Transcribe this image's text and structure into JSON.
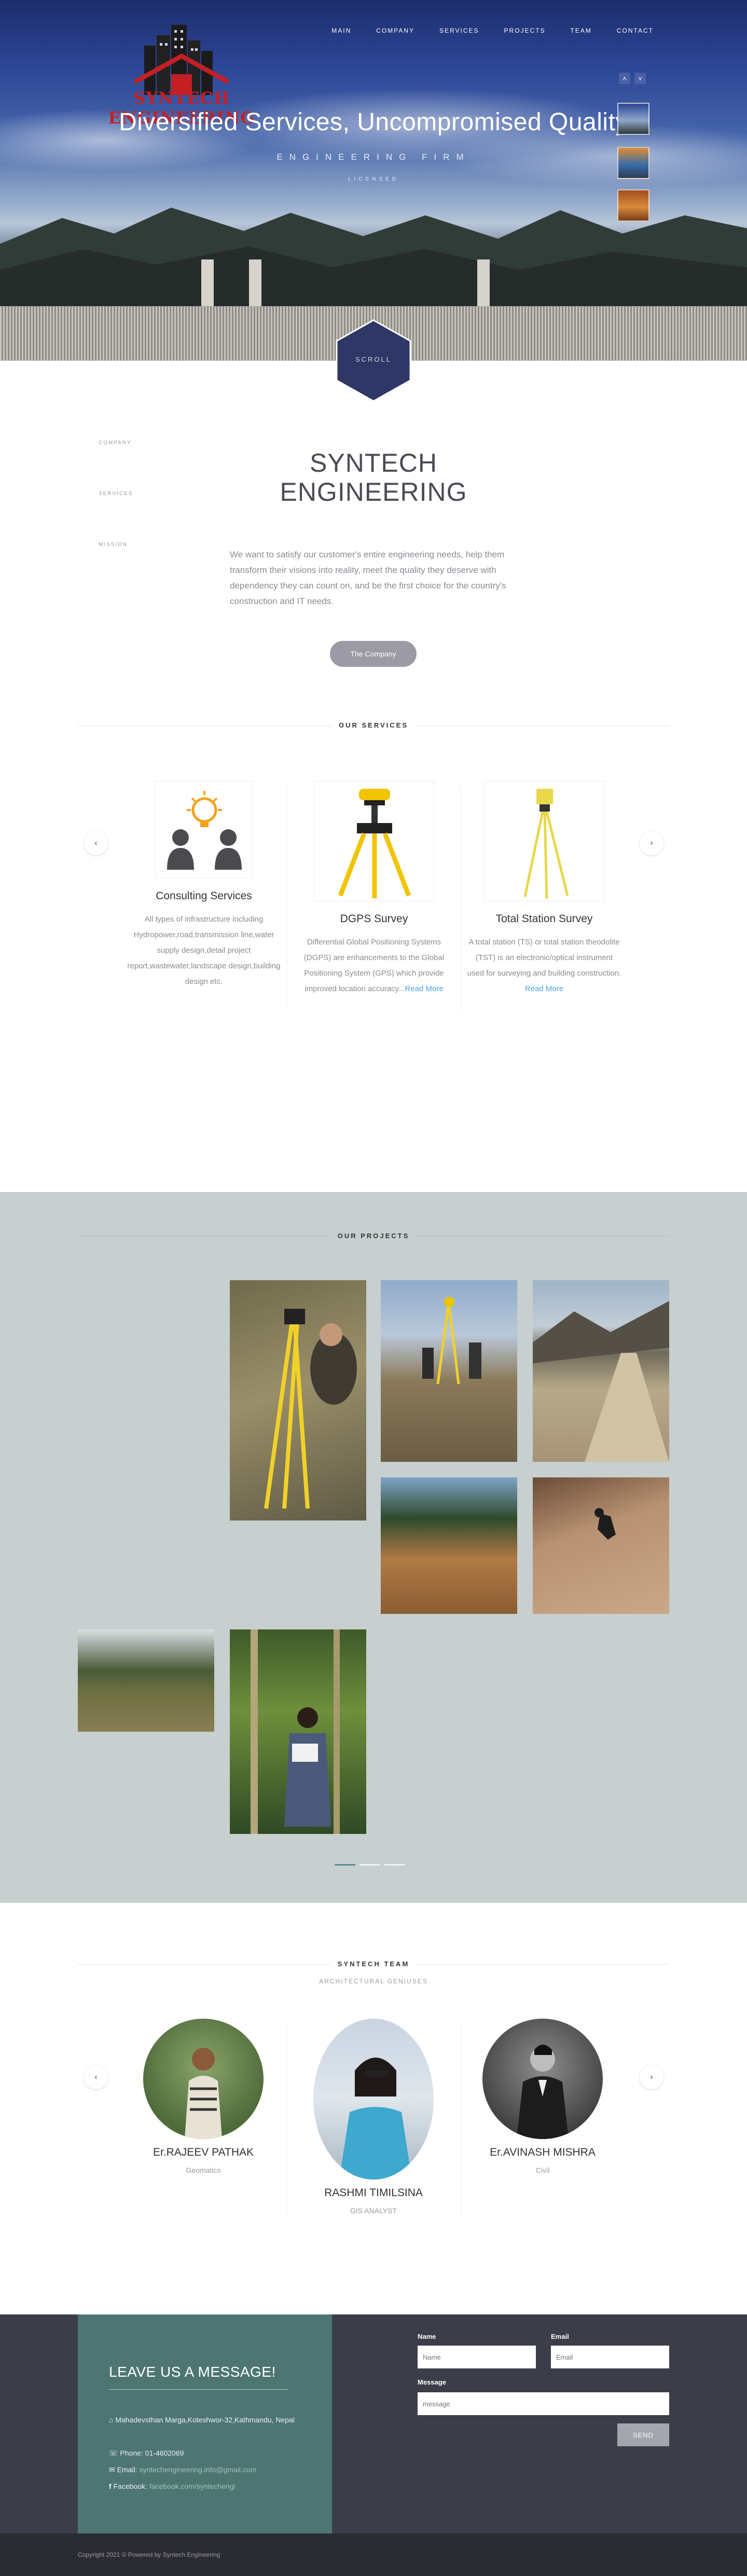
{
  "brand": {
    "name": "SYNTECH ENGINEERING",
    "color": "#c32026"
  },
  "nav": [
    "MAIN",
    "COMPANY",
    "SERVICES",
    "PROJECTS",
    "TEAM",
    "CONTACT"
  ],
  "hero": {
    "title": "Diversified Services, Uncompromised Quality",
    "subtitle": "ENGINEERING FIRM",
    "tagline": "LICENSED",
    "scroll_label": "SCROLL",
    "arrow_up": "˄",
    "arrow_down": "˅"
  },
  "about": {
    "side_links": [
      "COMPANY",
      "SERVICES",
      "MISSION"
    ],
    "title_line1": "SYNTECH",
    "title_line2": "ENGINEERING",
    "text": "We want to satisfy our customer's entire engineering needs, help them transform their visions into reality, meet the quality they deserve with dependency they can count on, and be the first choice for the country's construction and IT needs.",
    "button": "The Company"
  },
  "services": {
    "heading": "OUR SERVICES",
    "prev": "‹",
    "next": "›",
    "items": [
      {
        "title": "Consulting Services",
        "text": "All types of infrastructure including Hydropower,road,transmission line,water supply design,detail project report,wastewater,landscape design,building design etc.",
        "more": ""
      },
      {
        "title": "DGPS Survey",
        "text": "Differential Global Positioning Systems (DGPS) are enhancements to the Global Positioning System (GPS) which provide improved location accuracy...",
        "more": "Read More"
      },
      {
        "title": "Total Station Survey",
        "text": "A total station (TS) or total station theodolite (TST) is an electronic/optical instrument used for surveying and building construction.",
        "more": "Read More"
      }
    ]
  },
  "projects": {
    "heading": "OUR PROJECTS",
    "pages": 3,
    "active_page": 1
  },
  "team": {
    "heading": "SYNTECH TEAM",
    "subheading": "ARCHITECTURAL GENIUSES",
    "prev": "‹",
    "next": "›",
    "members": [
      {
        "name": "Er.RAJEEV PATHAK",
        "role": "Geomatics"
      },
      {
        "name": "RASHMI TIMILSINA",
        "role": "GIS ANALYST"
      },
      {
        "name": "Er.AVINASH MISHRA",
        "role": "Civil"
      }
    ]
  },
  "contact": {
    "title": "LEAVE US A MESSAGE!",
    "address": "Mahadevsthan Marga,Koteshwor-32,Kathmandu, Nepal",
    "phone_label": "Phone:",
    "phone": "01-4602069",
    "email_label": "Email:",
    "email": "syntechengineering.info@gmail.com",
    "facebook_label": "Facebook:",
    "facebook": "facebook.com/syntechengi",
    "form": {
      "name_label": "Name",
      "name_placeholder": "Name",
      "email_label": "Email",
      "email_placeholder": "Email",
      "message_label": "Message",
      "message_placeholder": "message",
      "send": "SEND"
    }
  },
  "footer": {
    "copyright": "Copyright 2021 © Powered by Syntech Engineering"
  }
}
